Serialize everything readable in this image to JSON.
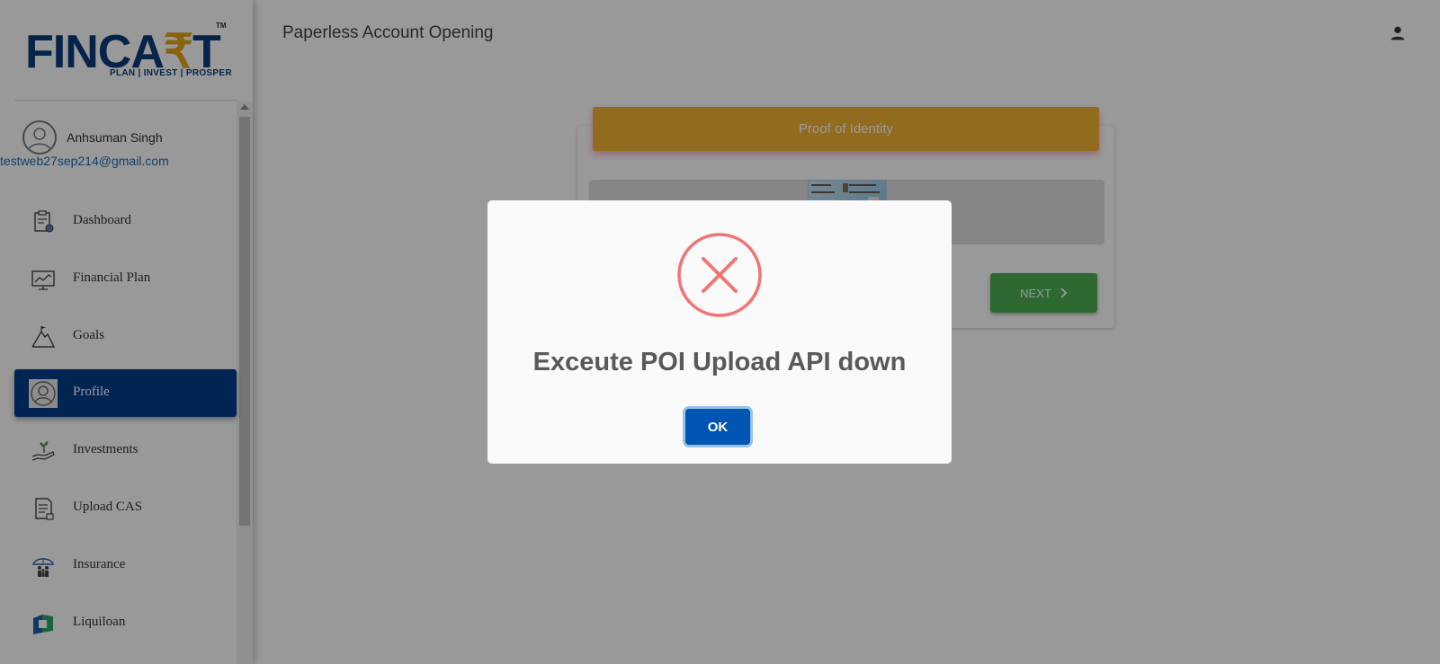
{
  "brand": {
    "logo_main_before": "FINCA",
    "logo_rupee": "₹",
    "logo_main_after": "T",
    "logo_tm": "TM",
    "logo_tagline": "PLAN | INVEST | PROSPER",
    "primary_color": "#0a3d7a",
    "accent_color": "#e8a317"
  },
  "user": {
    "name": "Anhsuman Singh",
    "email": "testweb27sep214@gmail.com"
  },
  "sidebar": {
    "items": [
      {
        "label": "Dashboard",
        "icon": "clipboard-icon"
      },
      {
        "label": "Financial Plan",
        "icon": "chart-board-icon"
      },
      {
        "label": "Goals",
        "icon": "mountain-flag-icon"
      },
      {
        "label": "Profile",
        "icon": "user-icon",
        "active": true
      },
      {
        "label": "Investments",
        "icon": "hand-plant-icon"
      },
      {
        "label": "Upload CAS",
        "icon": "document-icon"
      },
      {
        "label": "Insurance",
        "icon": "umbrella-family-icon"
      },
      {
        "label": "Liquiloan",
        "icon": "liquiloan-icon"
      }
    ],
    "active_color": "#003f8a"
  },
  "header": {
    "title": "Paperless Account Opening"
  },
  "card": {
    "title": "Proof of Identity",
    "header_color": "#f2b233",
    "next_label": "NEXT",
    "next_color": "#4caf50"
  },
  "modal": {
    "message": "Exceute POI Upload API down",
    "ok_label": "OK",
    "icon": "error-x-icon",
    "icon_color": "#f27474"
  }
}
